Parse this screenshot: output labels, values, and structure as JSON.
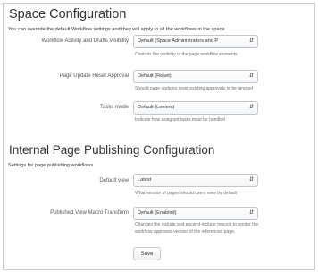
{
  "space_config": {
    "title": "Space Configuration",
    "description": "You can override the default Workflow settings and they will apply to all the workflows in the space",
    "fields": [
      {
        "label": "Workflow Activity and Drafts Visibility",
        "value": "Default (Space Administrators and P",
        "help": "Controls the visibility of the page workflow elements"
      },
      {
        "label": "Page Update Reset Approval",
        "value": "Default (Reset)",
        "help": "Should page updates reset existing approvals or be ignored"
      },
      {
        "label": "Tasks mode",
        "value": "Default (Lenient)",
        "help": "Indicate how assigned tasks must be handled"
      }
    ]
  },
  "publishing": {
    "title": "Internal Page Publishing Configuration",
    "description": "Settings for page publishing workflows",
    "fields": [
      {
        "label": "Default view",
        "value": "Latest",
        "help": "What version of pages should users view by default"
      },
      {
        "label": "Published View Macro Transform",
        "value": "Default (Enabled)",
        "help_line1": "Changes the include and excerpt-include macros to render the",
        "help_line2": "workflow approved version of the referenced page."
      }
    ]
  },
  "save_label": "Save",
  "icons": {
    "select_arrow": "updown-arrow-icon"
  }
}
